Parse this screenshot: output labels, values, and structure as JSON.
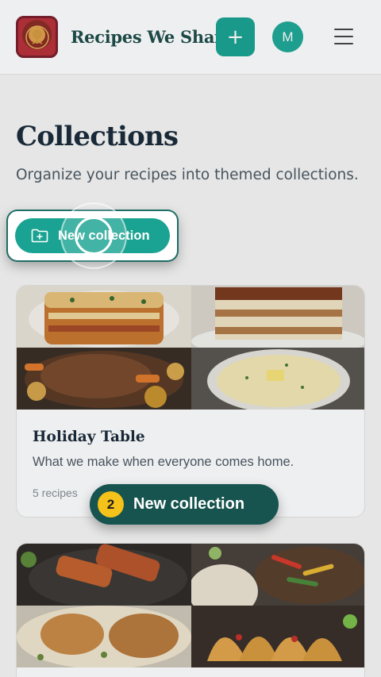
{
  "header": {
    "brand": "Recipes We Share",
    "add_icon": "plus-icon",
    "avatar_initial": "M",
    "menu_icon": "hamburger-icon",
    "accent_color": "#1aa392"
  },
  "page": {
    "title": "Collections",
    "subtitle": "Organize your recipes into themed collections."
  },
  "new_collection_button": {
    "label": "New collection",
    "icon": "folder-plus-icon"
  },
  "collections": [
    {
      "title": "Holiday Table",
      "description": "What we make when everyone comes home.",
      "count": "5 recipes",
      "images": [
        "lasagna",
        "tiramisu",
        "pot-roast",
        "mashed-potatoes"
      ]
    },
    {
      "title": "",
      "description": "",
      "count": "",
      "images": [
        "salmon",
        "fajitas",
        "chicken-pasta",
        "tacos"
      ]
    }
  ],
  "tutorial": {
    "step_number": "2",
    "step_label": "New collection",
    "badge_color": "#f4c21a"
  }
}
